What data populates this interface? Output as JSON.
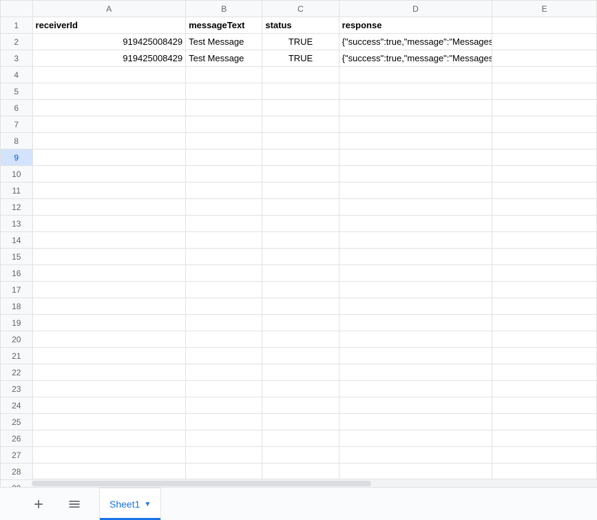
{
  "columns": [
    "A",
    "B",
    "C",
    "D",
    "E"
  ],
  "rowCount": 29,
  "selectedRow": 9,
  "headers": {
    "A": "receiverId",
    "B": "messageText",
    "C": "status",
    "D": "response"
  },
  "rows": [
    {
      "A": "919425008429",
      "B": "Test Message",
      "C": "TRUE",
      "D": "{\"success\":true,\"message\":\"Messages processed.\",\"resul"
    },
    {
      "A": "919425008429",
      "B": "Test Message",
      "C": "TRUE",
      "D": "{\"success\":true,\"message\":\"Messages processed.\",\"resul"
    }
  ],
  "sheetTab": {
    "name": "Sheet1"
  }
}
